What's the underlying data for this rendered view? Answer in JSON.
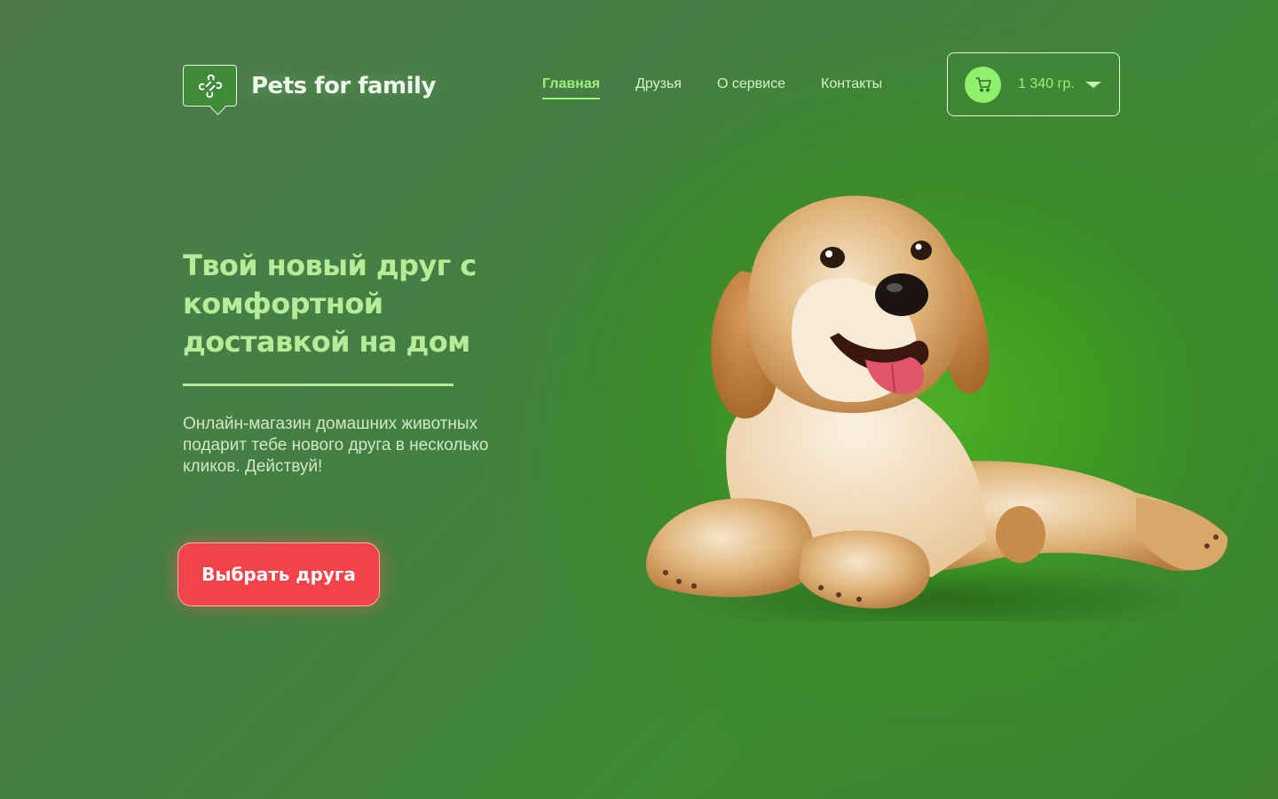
{
  "brand": {
    "name": "Pets for family",
    "logo_icon": "bone-icon"
  },
  "nav": {
    "items": [
      {
        "label": "Главная",
        "active": true
      },
      {
        "label": "Друзья",
        "active": false
      },
      {
        "label": "О сервисе",
        "active": false
      },
      {
        "label": "Контакты",
        "active": false
      }
    ]
  },
  "cart": {
    "icon": "cart-icon",
    "amount": "1 340 гр."
  },
  "hero": {
    "title": "Твой новый друг с комфортной доставкой на дом",
    "subtitle": "Онлайн-магазин домашних животных подарит тебе нового друга в несколько кликов. Действуй!",
    "cta_label": "Выбрать друга",
    "image": "puppy-illustration"
  },
  "colors": {
    "accent_green": "#9ff07a",
    "cta_red": "#f0444a",
    "background_green": "#447f42"
  }
}
